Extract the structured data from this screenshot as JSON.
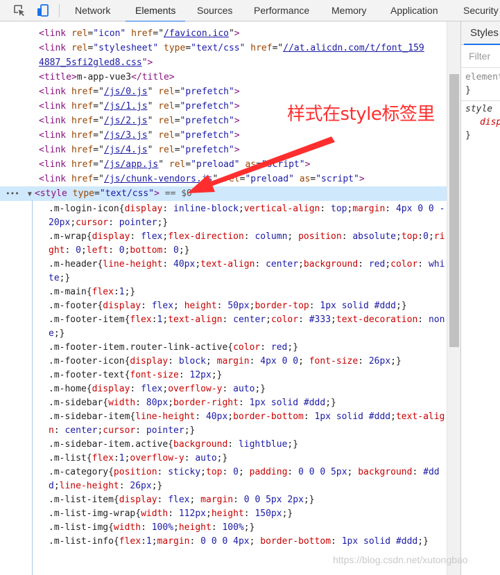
{
  "toolbar": {
    "tabs": [
      "Network",
      "Elements",
      "Sources",
      "Performance",
      "Memory",
      "Application",
      "Security"
    ],
    "active_tab": "Elements",
    "accent_color": "#1a73e8"
  },
  "elements": {
    "lines": [
      {
        "open": "<",
        "tag": "link",
        "a1": "rel",
        "v1": "\"icon\"",
        "a2": "href",
        "v2": "/favicon.ico",
        "close": ">"
      },
      {
        "open": "<",
        "tag": "link",
        "a1": "rel",
        "v1": "\"stylesheet\"",
        "a2": "type",
        "v2": "\"text/css\"",
        "a3": "href",
        "v3": "//at.alicdn.com/t/font_159",
        "close": ""
      },
      {
        "cont": "4887_5sfi2gled8.css",
        "close": "\">"
      },
      {
        "open": "<",
        "tag": "title",
        "text": "m-app-vue3",
        "endtag": "title"
      },
      {
        "open": "<",
        "tag": "link",
        "a1": "href",
        "v1": "/js/0.js",
        "a2": "rel",
        "v2": "\"prefetch\"",
        "close": ">"
      },
      {
        "open": "<",
        "tag": "link",
        "a1": "href",
        "v1": "/js/1.js",
        "a2": "rel",
        "v2": "\"prefetch\"",
        "close": ">"
      },
      {
        "open": "<",
        "tag": "link",
        "a1": "href",
        "v1": "/js/2.js",
        "a2": "rel",
        "v2": "\"prefetch\"",
        "close": ">"
      },
      {
        "open": "<",
        "tag": "link",
        "a1": "href",
        "v1": "/js/3.js",
        "a2": "rel",
        "v2": "\"prefetch\"",
        "close": ">"
      },
      {
        "open": "<",
        "tag": "link",
        "a1": "href",
        "v1": "/js/4.js",
        "a2": "rel",
        "v2": "\"prefetch\"",
        "close": ">"
      },
      {
        "open": "<",
        "tag": "link",
        "a1": "href",
        "v1": "/js/app.js",
        "a2": "rel",
        "v2": "\"preload\"",
        "a3": "as",
        "v3": "\"script\"",
        "close": ">"
      },
      {
        "open": "<",
        "tag": "link",
        "a1": "href",
        "v1": "/js/chunk-vendors.js",
        "a2": "rel",
        "v2": "\"preload\"",
        "a3": "as",
        "v3": "\"script\"",
        "close": ">"
      }
    ],
    "selected_node": {
      "dots": "•••",
      "tag": "style",
      "attr": "type",
      "value": "\"text/css\"",
      "marker": "== $0"
    },
    "css_rules": [
      ".m-login-icon{display: inline-block;vertical-align: top;margin: 4px 0 0 -20px;cursor: pointer;}",
      ".m-wrap{display: flex;flex-direction: column; position: absolute;top:0;right: 0;left: 0;bottom: 0;}",
      ".m-header{line-height: 40px;text-align: center;background: red;color: white;}",
      ".m-main{flex:1;}",
      ".m-footer{display: flex; height: 50px;border-top: 1px solid #ddd;}",
      ".m-footer-item{flex:1;text-align: center;color: #333;text-decoration: none;}",
      ".m-footer-item.router-link-active{color: red;}",
      ".m-footer-icon{display: block; margin: 4px 0 0; font-size: 26px;}",
      ".m-footer-text{font-size: 12px;}",
      ".m-home{display: flex;overflow-y: auto;}",
      ".m-sidebar{width: 80px;border-right: 1px solid #ddd;}",
      ".m-sidebar-item{line-height: 40px;border-bottom: 1px solid #ddd;text-align: center;cursor: pointer;}",
      ".m-sidebar-item.active{background: lightblue;}",
      ".m-list{flex:1;overflow-y: auto;}",
      ".m-category{position: sticky;top: 0; padding: 0 0 0 5px; background: #ddd;line-height: 26px;}",
      ".m-list-item{display: flex; margin: 0 0 5px 2px;}",
      ".m-list-img-wrap{width: 112px;height: 150px;}",
      ".m-list-img{width: 100%;height: 100%;}",
      ".m-list-info{flex:1;margin: 0 0 0 4px; border-bottom: 1px solid #ddd;}"
    ]
  },
  "styles_pane": {
    "tab_label": "Styles",
    "filter_placeholder": "Filter",
    "rule1_selector": "element",
    "rule1_close": "}",
    "rule2_selector": "style",
    "rule2_prop": "disp",
    "rule2_close": "}"
  },
  "annotation": {
    "text": "样式在style标签里",
    "color": "#ff2e2e"
  },
  "watermark": "https://blog.csdn.net/xutongbao"
}
